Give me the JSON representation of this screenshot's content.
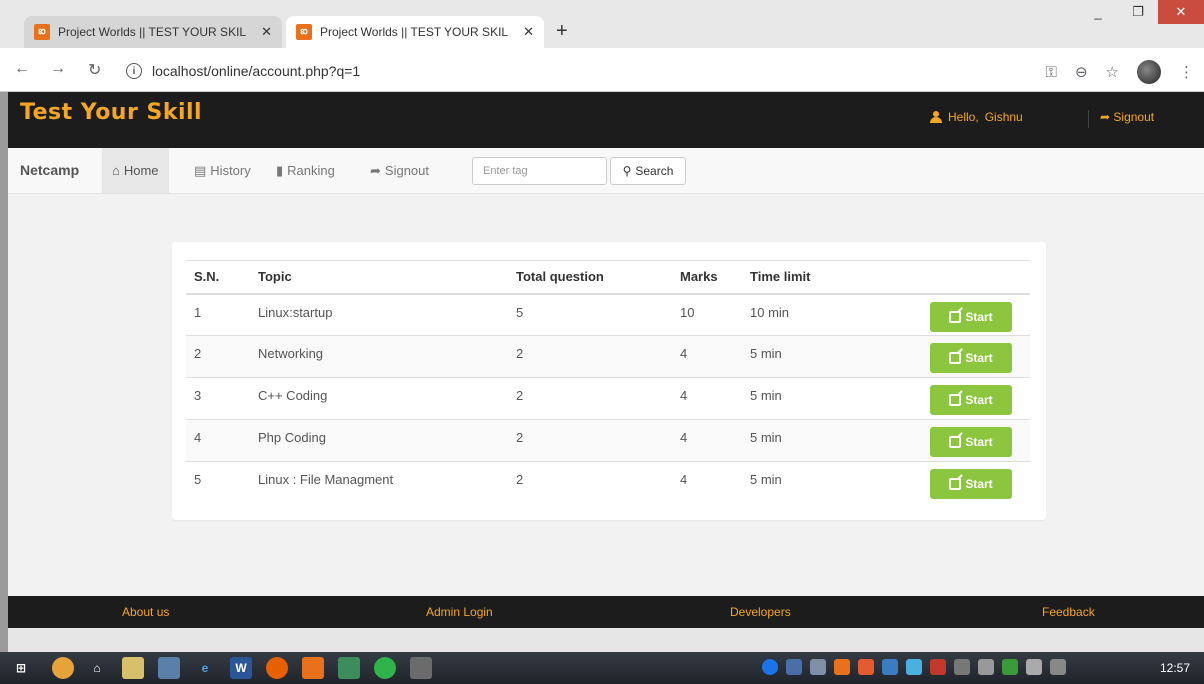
{
  "browser": {
    "tabs": [
      {
        "title": "Project Worlds || TEST YOUR SKIL",
        "favicon": "xampp-icon",
        "active": false
      },
      {
        "title": "Project Worlds || TEST YOUR SKIL",
        "favicon": "xampp-icon",
        "active": true
      }
    ],
    "new_tab_label": "+",
    "url": "localhost/online/account.php?q=1",
    "window_controls": {
      "minimize": "_",
      "maximize": "❐",
      "close": "✕"
    }
  },
  "header": {
    "logo": "Test Your Skill",
    "greeting": "Hello,",
    "username": "Gishnu",
    "signout": "Signout"
  },
  "nav": {
    "brand": "Netcamp",
    "items": [
      {
        "label": "Home",
        "icon": "home-icon",
        "active": true
      },
      {
        "label": "History",
        "icon": "list-icon",
        "active": false
      },
      {
        "label": "Ranking",
        "icon": "bar-chart-icon",
        "active": false
      },
      {
        "label": "Signout",
        "icon": "signout-icon",
        "active": false
      }
    ],
    "search_placeholder": "Enter tag",
    "search_button": "Search"
  },
  "table": {
    "headers": [
      "S.N.",
      "Topic",
      "Total question",
      "Marks",
      "Time limit"
    ],
    "rows": [
      {
        "sn": "1",
        "topic": "Linux:startup",
        "total": "5",
        "marks": "10",
        "time": "10 min"
      },
      {
        "sn": "2",
        "topic": "Networking",
        "total": "2",
        "marks": "4",
        "time": "5 min"
      },
      {
        "sn": "3",
        "topic": "C++ Coding",
        "total": "2",
        "marks": "4",
        "time": "5 min"
      },
      {
        "sn": "4",
        "topic": "Php Coding",
        "total": "2",
        "marks": "4",
        "time": "5 min"
      },
      {
        "sn": "5",
        "topic": "Linux : File Managment",
        "total": "2",
        "marks": "4",
        "time": "5 min"
      }
    ],
    "start_label": "Start"
  },
  "footer": {
    "links": [
      "About us",
      "Admin Login",
      "Developers",
      "Feedback"
    ]
  },
  "taskbar": {
    "clock": "12:57"
  },
  "colors": {
    "accent": "#f5a623",
    "start_button": "#8cc63f",
    "header_bg": "#1c1c1c"
  }
}
